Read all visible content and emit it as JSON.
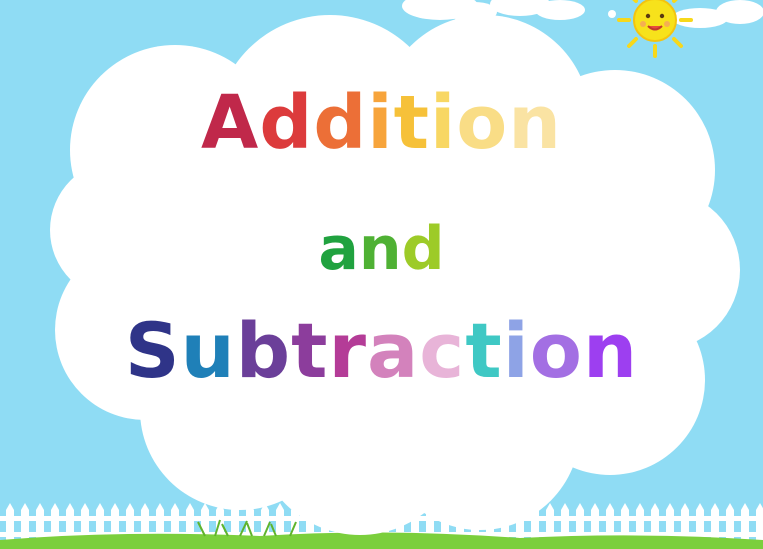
{
  "slide": {
    "title_lines": [
      {
        "letters": [
          {
            "ch": "A",
            "color": "#c0284a"
          },
          {
            "ch": "d",
            "color": "#dc3b3c"
          },
          {
            "ch": "d",
            "color": "#ec6f37"
          },
          {
            "ch": "i",
            "color": "#f7a43b"
          },
          {
            "ch": "t",
            "color": "#f6c139"
          },
          {
            "ch": "i",
            "color": "#f8d763"
          },
          {
            "ch": "o",
            "color": "#f9dd86"
          },
          {
            "ch": "n",
            "color": "#fae3a3"
          }
        ]
      },
      {
        "letters": [
          {
            "ch": "a",
            "color": "#20a23f"
          },
          {
            "ch": "n",
            "color": "#4fb134"
          },
          {
            "ch": "d",
            "color": "#9dcb28"
          }
        ]
      },
      {
        "letters": [
          {
            "ch": "S",
            "color": "#2f3488"
          },
          {
            "ch": "u",
            "color": "#1f80b8"
          },
          {
            "ch": "b",
            "color": "#6b3f99"
          },
          {
            "ch": "t",
            "color": "#8c3d9c"
          },
          {
            "ch": "r",
            "color": "#b43c97"
          },
          {
            "ch": "a",
            "color": "#d382bc"
          },
          {
            "ch": "c",
            "color": "#e8b4d8"
          },
          {
            "ch": "t",
            "color": "#3fc8c4"
          },
          {
            "ch": "i",
            "color": "#8ea3e6"
          },
          {
            "ch": "o",
            "color": "#a36fe3"
          },
          {
            "ch": "n",
            "color": "#9d3ff0"
          }
        ]
      }
    ]
  },
  "colors": {
    "sky": "#8fdcf4",
    "cloud": "#ffffff",
    "fence": "#ffffff",
    "grass": "#7bcf3c",
    "sun": "#f7e21b"
  },
  "icons": {
    "sun": "smiling-sun-icon"
  }
}
